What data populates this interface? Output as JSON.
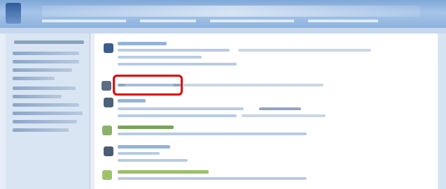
{
  "window": {
    "title": "",
    "colors": {
      "titlebar": "#8bb2de",
      "sidebar": "#d9e5f3",
      "content": "#ffffff",
      "highlight": "#e00000"
    }
  },
  "sidebar": {
    "items": [
      {
        "label": ""
      },
      {
        "label": ""
      },
      {
        "label": ""
      },
      {
        "label": ""
      },
      {
        "label": ""
      },
      {
        "label": ""
      },
      {
        "label": ""
      },
      {
        "label": ""
      },
      {
        "label": ""
      },
      {
        "label": ""
      },
      {
        "label": ""
      }
    ]
  },
  "main": {
    "sections": [
      {
        "icon": "monitor-icon",
        "title": ""
      },
      {
        "icon": "computer-icon",
        "title": ""
      },
      {
        "icon": "printer-icon",
        "title": ""
      },
      {
        "icon": "network-icon",
        "title": ""
      },
      {
        "icon": "user-icon",
        "title": ""
      },
      {
        "icon": "globe-icon",
        "title": ""
      }
    ],
    "highlighted_link": ""
  }
}
